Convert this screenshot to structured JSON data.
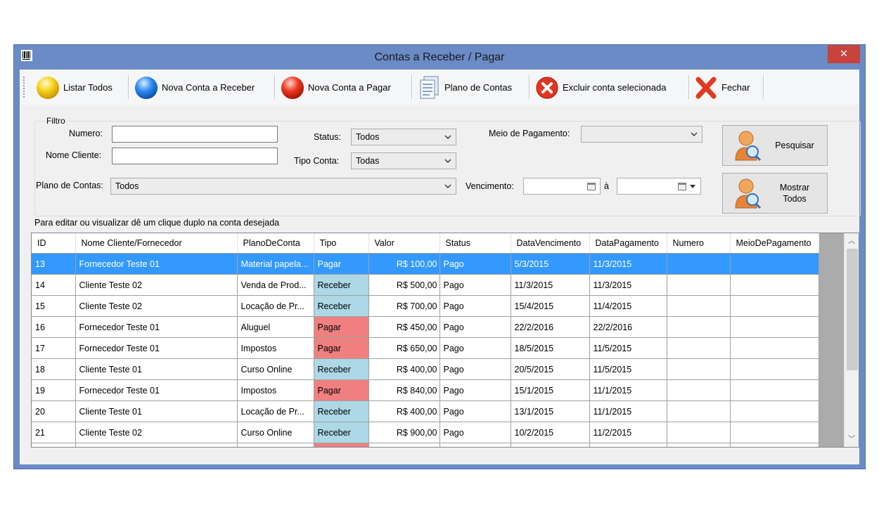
{
  "window": {
    "title": "Contas a Receber / Pagar",
    "close_label": "✕"
  },
  "toolbar": {
    "listar_todos": "Listar Todos",
    "nova_receber": "Nova Conta a Receber",
    "nova_pagar": "Nova Conta a Pagar",
    "plano_contas": "Plano de Contas",
    "excluir": "Excluir conta selecionada",
    "fechar": "Fechar"
  },
  "filter": {
    "legend": "Filtro",
    "numero_label": "Numero:",
    "numero_value": "",
    "nome_label": "Nome Cliente:",
    "nome_value": "",
    "status_label": "Status:",
    "status_value": "Todos",
    "tipo_label": "Tipo Conta:",
    "tipo_value": "Todas",
    "meio_label": "Meio de Pagamento:",
    "meio_value": "",
    "plano_label": "Plano de Contas:",
    "plano_value": "Todos",
    "vencimento_label": "Vencimento:",
    "vencimento_sep": "à",
    "pesquisar": "Pesquisar",
    "mostrar_todos_1": "Mostrar",
    "mostrar_todos_2": "Todos"
  },
  "hint": "Para editar ou visualizar dê um clique duplo na conta desejada",
  "grid": {
    "columns": [
      "ID",
      "Nome Cliente/Fornecedor",
      "PlanoDeConta",
      "Tipo",
      "Valor",
      "Status",
      "DataVencimento",
      "DataPagamento",
      "Numero",
      "MeioDePagamento"
    ],
    "rows": [
      {
        "id": "13",
        "nome": "Fornecedor Teste 01",
        "plano": "Material papela...",
        "tipo": "Pagar",
        "valor": "R$ 100,00",
        "status": "Pago",
        "venc": "5/3/2015",
        "pag": "11/3/2015",
        "numero": "",
        "meio": ""
      },
      {
        "id": "14",
        "nome": "Cliente Teste 02",
        "plano": "Venda de Prod...",
        "tipo": "Receber",
        "valor": "R$ 500,00",
        "status": "Pago",
        "venc": "11/3/2015",
        "pag": "11/3/2015",
        "numero": "",
        "meio": ""
      },
      {
        "id": "15",
        "nome": "Cliente Teste 02",
        "plano": "Locação de Pr...",
        "tipo": "Receber",
        "valor": "R$ 700,00",
        "status": "Pago",
        "venc": "15/4/2015",
        "pag": "11/4/2015",
        "numero": "",
        "meio": ""
      },
      {
        "id": "16",
        "nome": "Fornecedor Teste 01",
        "plano": "Aluguel",
        "tipo": "Pagar",
        "valor": "R$ 450,00",
        "status": "Pago",
        "venc": "22/2/2016",
        "pag": "22/2/2016",
        "numero": "",
        "meio": ""
      },
      {
        "id": "17",
        "nome": "Fornecedor Teste 01",
        "plano": "Impostos",
        "tipo": "Pagar",
        "valor": "R$ 650,00",
        "status": "Pago",
        "venc": "18/5/2015",
        "pag": "11/5/2015",
        "numero": "",
        "meio": ""
      },
      {
        "id": "18",
        "nome": "Cliente Teste 01",
        "plano": "Curso Online",
        "tipo": "Receber",
        "valor": "R$ 400,00",
        "status": "Pago",
        "venc": "20/5/2015",
        "pag": "11/5/2015",
        "numero": "",
        "meio": ""
      },
      {
        "id": "19",
        "nome": "Fornecedor Teste 01",
        "plano": "Impostos",
        "tipo": "Pagar",
        "valor": "R$ 840,00",
        "status": "Pago",
        "venc": "15/1/2015",
        "pag": "11/1/2015",
        "numero": "",
        "meio": ""
      },
      {
        "id": "20",
        "nome": "Cliente Teste 01",
        "plano": "Locação de Pr...",
        "tipo": "Receber",
        "valor": "R$ 400,00",
        "status": "Pago",
        "venc": "13/1/2015",
        "pag": "11/1/2015",
        "numero": "",
        "meio": ""
      },
      {
        "id": "21",
        "nome": "Cliente Teste 02",
        "plano": "Curso Online",
        "tipo": "Receber",
        "valor": "R$ 900,00",
        "status": "Pago",
        "venc": "10/2/2015",
        "pag": "11/2/2015",
        "numero": "",
        "meio": ""
      }
    ],
    "selected_row": 0
  },
  "colors": {
    "selection": "#3399ff",
    "receber": "#add8e6",
    "pagar": "#f08080",
    "title_bar": "#6a8bc6",
    "close": "#c7433b"
  }
}
